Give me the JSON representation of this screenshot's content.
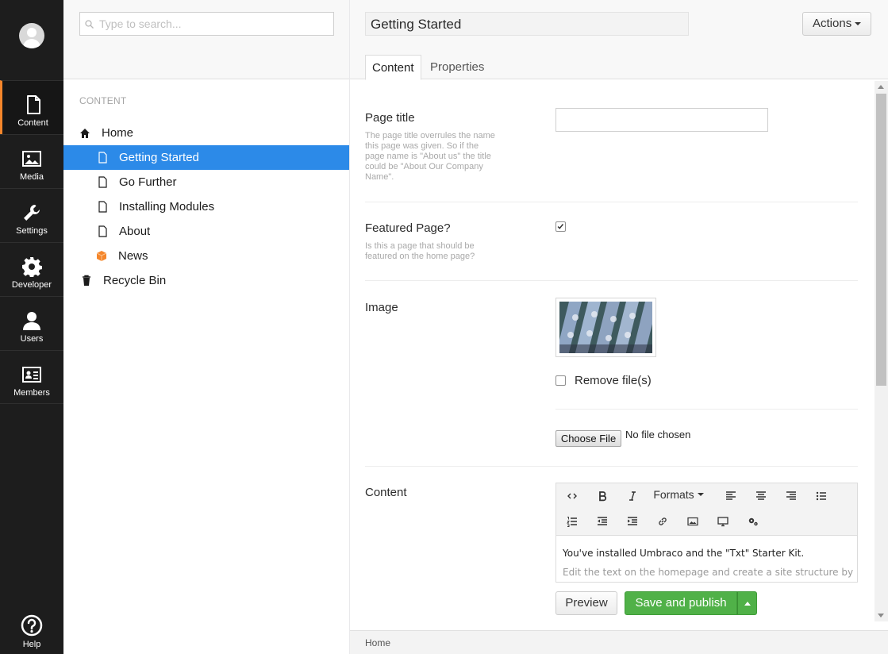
{
  "nav": {
    "sections": [
      {
        "label": "Content",
        "icon": "document-icon",
        "active": true
      },
      {
        "label": "Media",
        "icon": "image-icon"
      },
      {
        "label": "Settings",
        "icon": "wrench-icon"
      },
      {
        "label": "Developer",
        "icon": "gear-icon"
      },
      {
        "label": "Users",
        "icon": "user-icon"
      },
      {
        "label": "Members",
        "icon": "id-card-icon"
      }
    ],
    "help_label": "Help"
  },
  "tree": {
    "search_placeholder": "Type to search...",
    "heading": "CONTENT",
    "nodes": [
      {
        "label": "Home",
        "icon": "home-icon"
      },
      {
        "label": "Getting Started",
        "icon": "document-icon",
        "selected": true
      },
      {
        "label": "Go Further",
        "icon": "document-icon"
      },
      {
        "label": "Installing Modules",
        "icon": "document-icon"
      },
      {
        "label": "About",
        "icon": "document-icon"
      },
      {
        "label": "News",
        "icon": "box-icon"
      },
      {
        "label": "Recycle Bin",
        "icon": "trash-icon"
      }
    ]
  },
  "editor": {
    "node_name": "Getting Started",
    "actions_label": "Actions",
    "tabs": [
      "Content",
      "Properties"
    ],
    "properties": {
      "page_title": {
        "label": "Page title",
        "description": "The page title overrules the name this page was given. So if the page name is \"About us\" the title could be \"About Our Company Name\".",
        "value": ""
      },
      "featured": {
        "label": "Featured Page?",
        "description": "Is this a page that should be featured on the home page?",
        "checked": true
      },
      "image": {
        "label": "Image",
        "remove_label": "Remove file(s)",
        "choose_file_label": "Choose File",
        "no_file_text": "No file chosen"
      },
      "content": {
        "label": "Content",
        "formats_label": "Formats",
        "text_line1": "You've installed Umbraco and the \"Txt\" Starter Kit.",
        "text_line2": "Edit the text on the homepage and create a site structure by"
      }
    },
    "buttons": {
      "preview": "Preview",
      "save_publish": "Save and publish"
    },
    "breadcrumb": "Home"
  },
  "colors": {
    "nav_bg": "#1d1d1d",
    "active_accent": "#f5862b",
    "selected_node": "#2c8ae8",
    "publish_green": "#50b148"
  }
}
